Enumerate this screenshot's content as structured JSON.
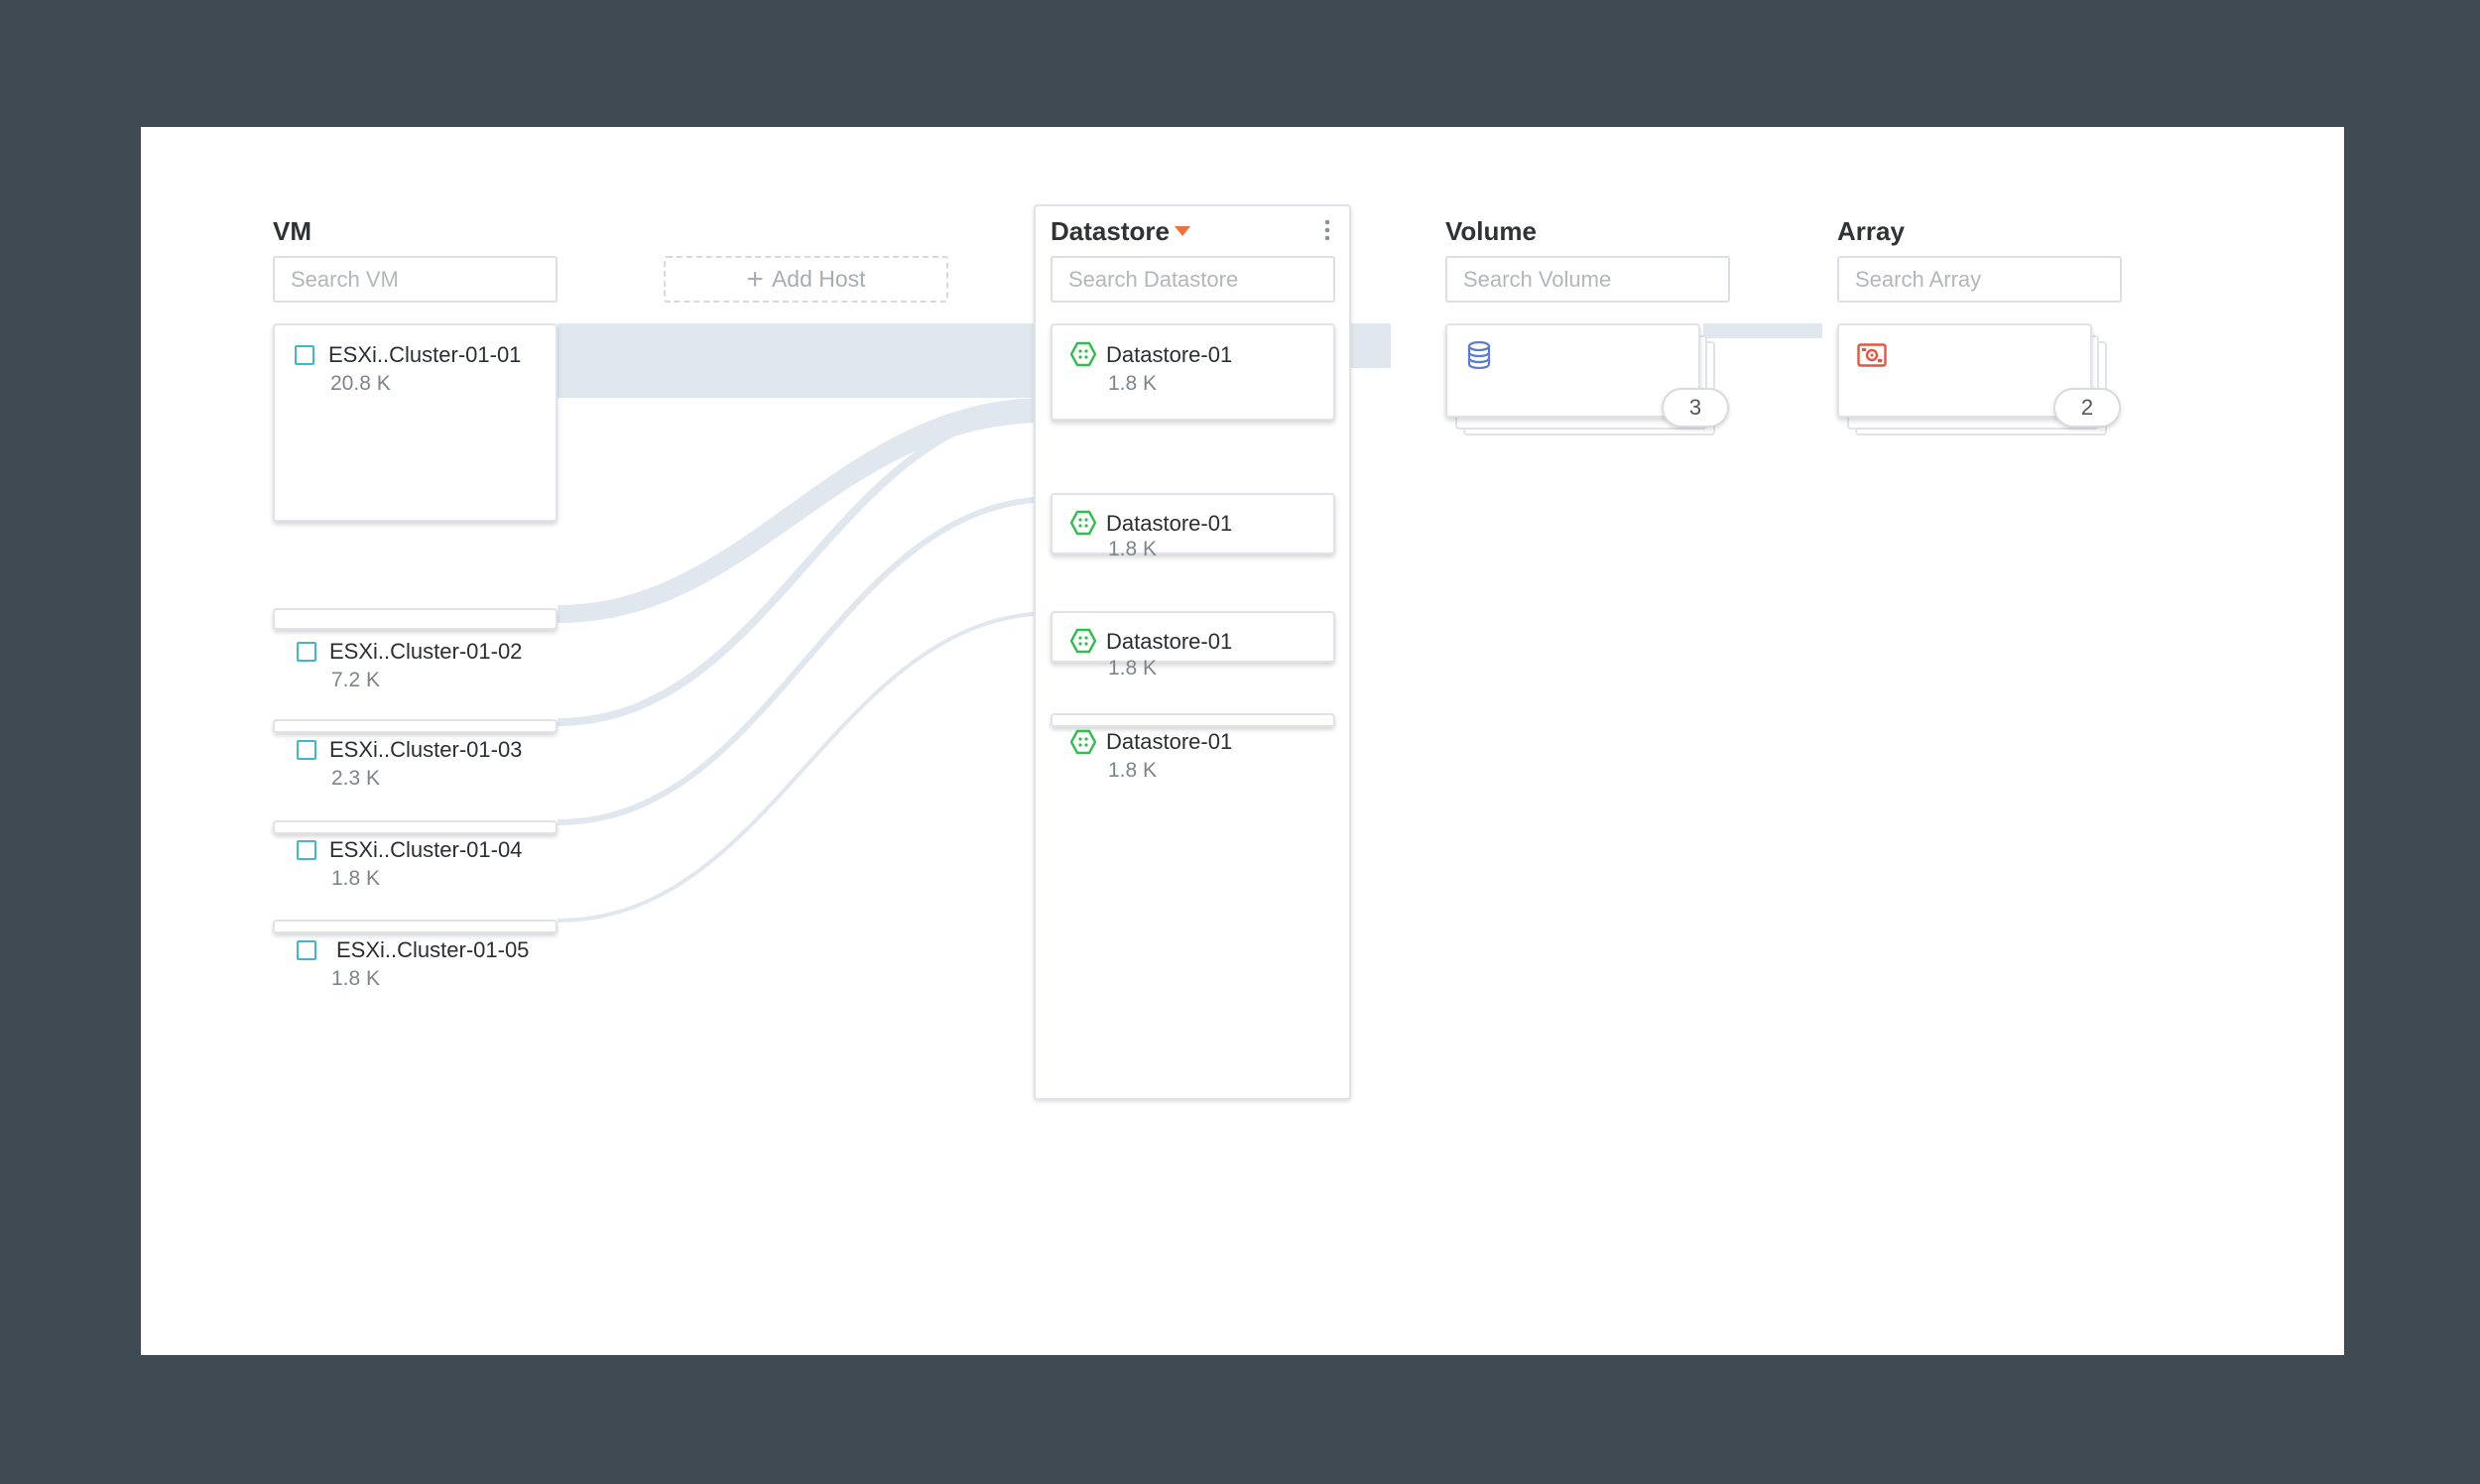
{
  "columns": {
    "vm": {
      "title": "VM",
      "search_placeholder": "Search VM"
    },
    "add_host": {
      "label": "Add Host",
      "icon": "plus-icon"
    },
    "datastore": {
      "title": "Datastore",
      "search_placeholder": "Search Datastore",
      "menu_icon": "more-vertical-icon",
      "sort_icon": "caret-down-icon"
    },
    "volume": {
      "title": "Volume",
      "search_placeholder": "Search Volume",
      "icon": "database-icon",
      "count": "3"
    },
    "array": {
      "title": "Array",
      "search_placeholder": "Search Array",
      "icon": "storage-array-icon",
      "count": "2"
    }
  },
  "vms": [
    {
      "name": "ESXi..Cluster-01-01",
      "value": "20.8 K"
    },
    {
      "name": "ESXi..Cluster-01-02",
      "value": "7.2 K"
    },
    {
      "name": "ESXi..Cluster-01-03",
      "value": "2.3 K"
    },
    {
      "name": "ESXi..Cluster-01-04",
      "value": "1.8 K"
    },
    {
      "name": "ESXi..Cluster-01-05",
      "value": "1.8 K"
    }
  ],
  "datastores": [
    {
      "name": "Datastore-01",
      "value": "1.8 K"
    },
    {
      "name": "Datastore-01",
      "value": "1.8 K"
    },
    {
      "name": "Datastore-01",
      "value": "1.8 K"
    },
    {
      "name": "Datastore-01",
      "value": "1.8 K"
    }
  ],
  "colors": {
    "background": "#404a53",
    "flow": "#e1e7ef",
    "checkbox": "#3fb8cf",
    "datastore_icon": "#2fbf4c",
    "sort_caret": "#f0703c",
    "volume_icon": "#5b7bd5",
    "array_icon": "#e8553a"
  }
}
